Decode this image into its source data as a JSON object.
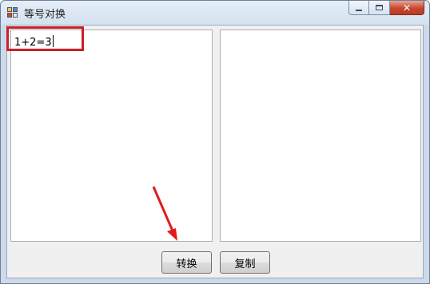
{
  "window": {
    "title": "等号对换",
    "controls": {
      "minimize": "minimize-icon",
      "maximize": "maximize-icon",
      "close": "close-icon",
      "close_glyph": "✕"
    }
  },
  "left_textbox": {
    "value": "1+2=3"
  },
  "right_textbox": {
    "value": ""
  },
  "buttons": {
    "convert_label": "转换",
    "copy_label": "复制"
  },
  "annotations": {
    "highlight_color": "#c8202a",
    "arrow_color": "#e11b1b"
  }
}
